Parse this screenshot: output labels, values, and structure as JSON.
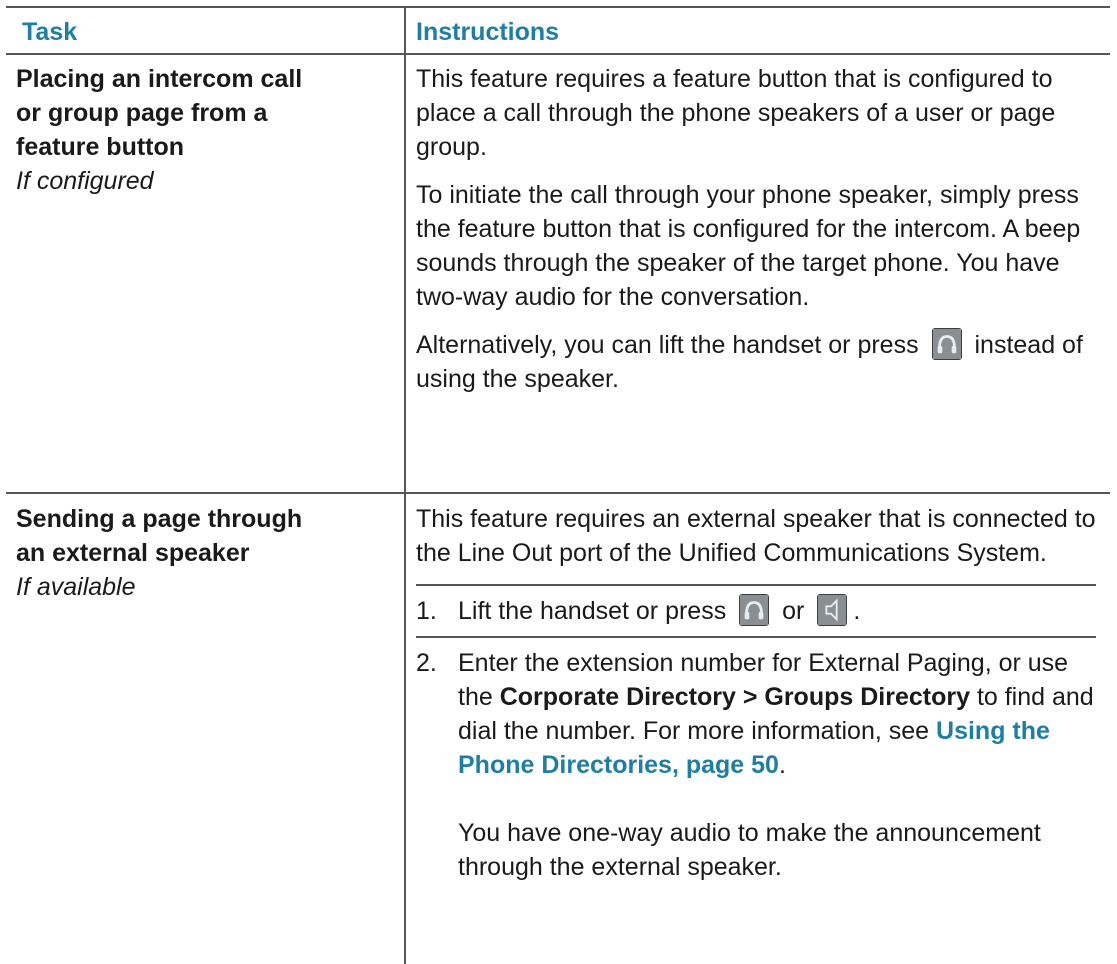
{
  "header": {
    "task": "Task",
    "instructions": "Instructions"
  },
  "rows": [
    {
      "task_title_1": "Placing an intercom call",
      "task_title_2": "or group page from a",
      "task_title_3": "feature button",
      "task_note": "If configured",
      "p1": "This feature requires a feature button that is configured to place a call through the phone speakers of a user or page group.",
      "p2": "To initiate the call through your phone speaker, simply press the feature button that is configured for the intercom. A beep sounds through the speaker of the target phone. You have two-way audio for the conversation.",
      "p3_before": "Alternatively, you can lift the handset or press",
      "p3_after": "instead of using the speaker.",
      "icons": [
        "headset-icon"
      ]
    },
    {
      "task_title_1": "Sending a page through",
      "task_title_2": "an external speaker",
      "task_note": "If available",
      "p1": "This feature requires an external speaker that is connected to the Line Out port of the Unified Communications System.",
      "step1_num": "1.",
      "step1_before": "Lift the handset or press",
      "step1_mid": "or",
      "step1_after": ".",
      "step2_num": "2.",
      "step2_a": "Enter the extension number for External Paging, or use the",
      "step2_bold": "Corporate Directory > Groups Directory",
      "step2_b": "to find and dial the number. For more information, see",
      "step2_link": "Using the Phone Directories, page 50",
      "step2_c": ".",
      "step2_extra": "You have one-way audio to make the announcement through the external speaker.",
      "icons": [
        "headset-icon",
        "speaker-icon"
      ]
    }
  ]
}
